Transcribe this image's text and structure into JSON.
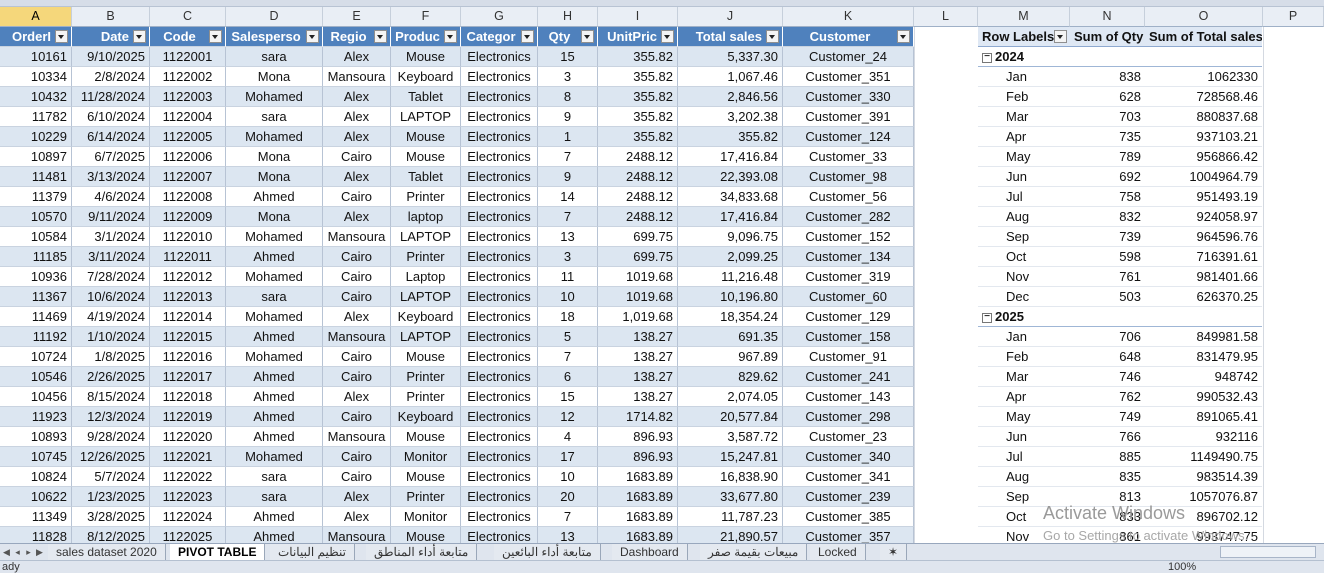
{
  "columns": [
    "A",
    "B",
    "C",
    "D",
    "E",
    "F",
    "G",
    "H",
    "I",
    "J",
    "K",
    "L",
    "M",
    "N",
    "O",
    "P"
  ],
  "table": {
    "headers": [
      "OrderI",
      "Date",
      "Code",
      "Salesperso",
      "Regio",
      "Produc",
      "Categor",
      "Qty",
      "UnitPric",
      "Total sales",
      "Customer"
    ],
    "rows": [
      [
        "10161",
        "9/10/2025",
        "1122001",
        "sara",
        "Alex",
        "Mouse",
        "Electronics",
        "15",
        "355.82",
        "5,337.30",
        "Customer_24"
      ],
      [
        "10334",
        "2/8/2024",
        "1122002",
        "Mona",
        "Mansoura",
        "Keyboard",
        "Electronics",
        "3",
        "355.82",
        "1,067.46",
        "Customer_351"
      ],
      [
        "10432",
        "11/28/2024",
        "1122003",
        "Mohamed",
        "Alex",
        "Tablet",
        "Electronics",
        "8",
        "355.82",
        "2,846.56",
        "Customer_330"
      ],
      [
        "11782",
        "6/10/2024",
        "1122004",
        "sara",
        "Alex",
        "LAPTOP",
        "Electronics",
        "9",
        "355.82",
        "3,202.38",
        "Customer_391"
      ],
      [
        "10229",
        "6/14/2024",
        "1122005",
        "Mohamed",
        "Alex",
        "Mouse",
        "Electronics",
        "1",
        "355.82",
        "355.82",
        "Customer_124"
      ],
      [
        "10897",
        "6/7/2025",
        "1122006",
        "Mona",
        "Cairo",
        "Mouse",
        "Electronics",
        "7",
        "2488.12",
        "17,416.84",
        "Customer_33"
      ],
      [
        "11481",
        "3/13/2024",
        "1122007",
        "Mona",
        "Alex",
        "Tablet",
        "Electronics",
        "9",
        "2488.12",
        "22,393.08",
        "Customer_98"
      ],
      [
        "11379",
        "4/6/2024",
        "1122008",
        "Ahmed",
        "Cairo",
        "Printer",
        "Electronics",
        "14",
        "2488.12",
        "34,833.68",
        "Customer_56"
      ],
      [
        "10570",
        "9/11/2024",
        "1122009",
        "Mona",
        "Alex",
        "laptop",
        "Electronics",
        "7",
        "2488.12",
        "17,416.84",
        "Customer_282"
      ],
      [
        "10584",
        "3/1/2024",
        "1122010",
        "Mohamed",
        "Mansoura",
        "LAPTOP",
        "Electronics",
        "13",
        "699.75",
        "9,096.75",
        "Customer_152"
      ],
      [
        "11185",
        "3/11/2024",
        "1122011",
        "Ahmed",
        "Cairo",
        "Printer",
        "Electronics",
        "3",
        "699.75",
        "2,099.25",
        "Customer_134"
      ],
      [
        "10936",
        "7/28/2024",
        "1122012",
        "Mohamed",
        "Cairo",
        "Laptop",
        "Electronics",
        "11",
        "1019.68",
        "11,216.48",
        "Customer_319"
      ],
      [
        "11367",
        "10/6/2024",
        "1122013",
        "sara",
        "Cairo",
        "LAPTOP",
        "Electronics",
        "10",
        "1019.68",
        "10,196.80",
        "Customer_60"
      ],
      [
        "11469",
        "4/19/2024",
        "1122014",
        "Mohamed",
        "Alex",
        "Keyboard",
        "Electronics",
        "18",
        "1,019.68",
        "18,354.24",
        "Customer_129"
      ],
      [
        "11192",
        "1/10/2024",
        "1122015",
        "Ahmed",
        "Mansoura",
        "LAPTOP",
        "Electronics",
        "5",
        "138.27",
        "691.35",
        "Customer_158"
      ],
      [
        "10724",
        "1/8/2025",
        "1122016",
        "Mohamed",
        "Cairo",
        "Mouse",
        "Electronics",
        "7",
        "138.27",
        "967.89",
        "Customer_91"
      ],
      [
        "10546",
        "2/26/2025",
        "1122017",
        "Ahmed",
        "Cairo",
        "Printer",
        "Electronics",
        "6",
        "138.27",
        "829.62",
        "Customer_241"
      ],
      [
        "10456",
        "8/15/2024",
        "1122018",
        "Ahmed",
        "Alex",
        "Printer",
        "Electronics",
        "15",
        "138.27",
        "2,074.05",
        "Customer_143"
      ],
      [
        "11923",
        "12/3/2024",
        "1122019",
        "Ahmed",
        "Cairo",
        "Keyboard",
        "Electronics",
        "12",
        "1714.82",
        "20,577.84",
        "Customer_298"
      ],
      [
        "10893",
        "9/28/2024",
        "1122020",
        "Ahmed",
        "Mansoura",
        "Mouse",
        "Electronics",
        "4",
        "896.93",
        "3,587.72",
        "Customer_23"
      ],
      [
        "10745",
        "12/26/2025",
        "1122021",
        "Mohamed",
        "Cairo",
        "Monitor",
        "Electronics",
        "17",
        "896.93",
        "15,247.81",
        "Customer_340"
      ],
      [
        "10824",
        "5/7/2024",
        "1122022",
        "sara",
        "Cairo",
        "Mouse",
        "Electronics",
        "10",
        "1683.89",
        "16,838.90",
        "Customer_341"
      ],
      [
        "10622",
        "1/23/2025",
        "1122023",
        "sara",
        "Alex",
        "Printer",
        "Electronics",
        "20",
        "1683.89",
        "33,677.80",
        "Customer_239"
      ],
      [
        "11349",
        "3/28/2025",
        "1122024",
        "Ahmed",
        "Alex",
        "Monitor",
        "Electronics",
        "7",
        "1683.89",
        "11,787.23",
        "Customer_385"
      ],
      [
        "11828",
        "8/12/2025",
        "1122025",
        "Ahmed",
        "Mansoura",
        "Mouse",
        "Electronics",
        "13",
        "1683.89",
        "21,890.57",
        "Customer_357"
      ]
    ]
  },
  "pivot": {
    "headers": [
      "Row Labels",
      "Sum of Qty",
      "Sum of Total sales"
    ],
    "years": [
      {
        "label": "2024",
        "months": [
          [
            "Jan",
            "838",
            "1062330"
          ],
          [
            "Feb",
            "628",
            "728568.46"
          ],
          [
            "Mar",
            "703",
            "880837.68"
          ],
          [
            "Apr",
            "735",
            "937103.21"
          ],
          [
            "May",
            "789",
            "956866.42"
          ],
          [
            "Jun",
            "692",
            "1004964.79"
          ],
          [
            "Jul",
            "758",
            "951493.19"
          ],
          [
            "Aug",
            "832",
            "924058.97"
          ],
          [
            "Sep",
            "739",
            "964596.76"
          ],
          [
            "Oct",
            "598",
            "716391.61"
          ],
          [
            "Nov",
            "761",
            "981401.66"
          ],
          [
            "Dec",
            "503",
            "626370.25"
          ]
        ]
      },
      {
        "label": "2025",
        "months": [
          [
            "Jan",
            "706",
            "849981.58"
          ],
          [
            "Feb",
            "648",
            "831479.95"
          ],
          [
            "Mar",
            "746",
            "948742"
          ],
          [
            "Apr",
            "762",
            "990532.43"
          ],
          [
            "May",
            "749",
            "891065.41"
          ],
          [
            "Jun",
            "766",
            "932116"
          ],
          [
            "Jul",
            "885",
            "1149490.75"
          ],
          [
            "Aug",
            "835",
            "983514.39"
          ],
          [
            "Sep",
            "813",
            "1057076.87"
          ],
          [
            "Oct",
            "833",
            "896702.12"
          ],
          [
            "Nov",
            "861",
            "993747.75"
          ]
        ]
      }
    ]
  },
  "tabs": [
    "sales dataset 2020",
    "PIVOT TABLE",
    "تنظيم البيانات",
    "متابعة أداء المناطق",
    "متابعة أداء البائعين",
    "Dashboard",
    "مبيعات بقيمة صفر",
    "Locked"
  ],
  "active_tab": "PIVOT TABLE",
  "watermark": {
    "line1": "Activate Windows",
    "line2": "Go to Settings to activate Windows."
  },
  "status": {
    "left": "ady",
    "zoom": "100%"
  }
}
